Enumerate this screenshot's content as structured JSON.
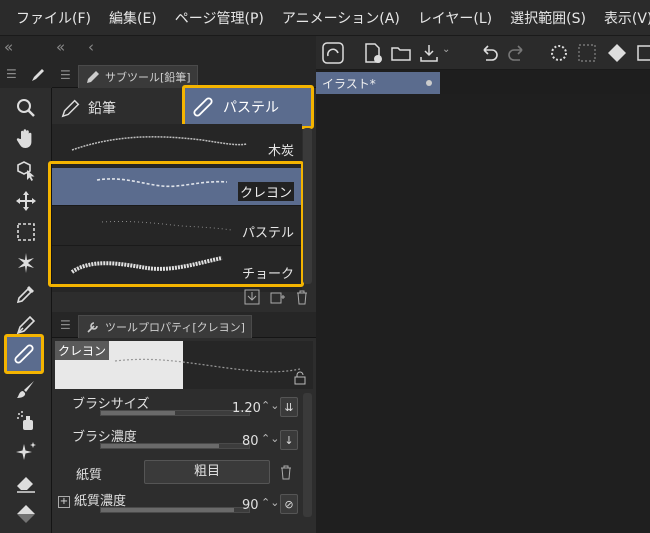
{
  "menubar": {
    "items": [
      "ファイル(F)",
      "編集(E)",
      "ページ管理(P)",
      "アニメーション(A)",
      "レイヤー(L)",
      "選択範囲(S)",
      "表示(V)"
    ]
  },
  "subtool_panel": {
    "tab_label": "サブツール[鉛筆]",
    "groups": [
      {
        "label": "鉛筆",
        "icon": "pencil-icon"
      },
      {
        "label": "パステル",
        "icon": "pastel-icon",
        "selected": true
      }
    ],
    "brushes": [
      {
        "label": "木炭"
      },
      {
        "label": "クレヨン",
        "selected": true
      },
      {
        "label": "パステル"
      },
      {
        "label": "チョーク"
      }
    ]
  },
  "document": {
    "tab_label": "イラスト*"
  },
  "tool_property": {
    "tab_label": "ツールプロパティ[クレヨン]",
    "preview_name": "クレヨン",
    "rows": [
      {
        "label": "ブラシサイズ",
        "value": "1.20",
        "fill_fraction": 0.5
      },
      {
        "label": "ブラシ濃度",
        "value": "80",
        "fill_fraction": 0.8
      },
      {
        "label": "紙質",
        "value": "粗目"
      },
      {
        "label": "紙質濃度",
        "value": "90",
        "fill_fraction": 0.9
      }
    ]
  },
  "colors": {
    "accent_highlight": "#f4b400",
    "selection": "#5b6c8e"
  }
}
